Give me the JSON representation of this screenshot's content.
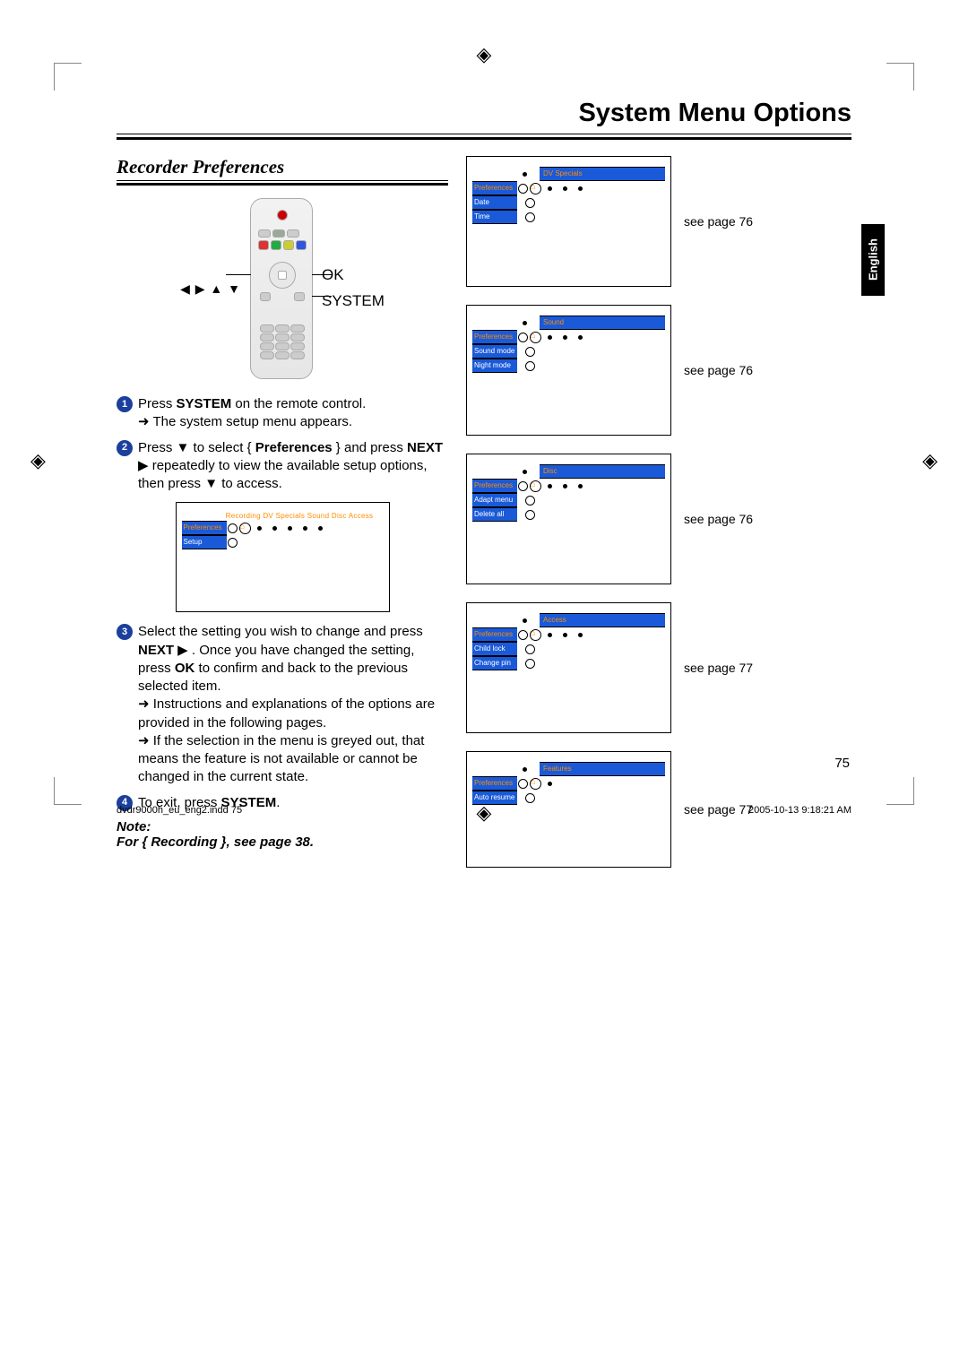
{
  "title": "System Menu Options",
  "section_heading": "Recorder Preferences",
  "language_tab": "English",
  "remote_labels": {
    "arrows": "◀ ▶ ▲ ▼",
    "ok": "OK",
    "system": "SYSTEM"
  },
  "steps": {
    "s1": {
      "num": "1",
      "text_a": "Press ",
      "bold_a": "SYSTEM",
      "text_b": " on the remote control.",
      "indent_a": "➜ The system setup menu appears."
    },
    "s2": {
      "num": "2",
      "text_a": "Press ▼ to select { ",
      "bold_a": "Preferences",
      "text_b": " } and press ",
      "bold_b": "NEXT",
      "text_c": " ▶  repeatedly to view the available setup options, then press ▼ to access."
    },
    "s3": {
      "num": "3",
      "text_a": "Select the setting you wish to change and press ",
      "bold_a": "NEXT",
      "text_b": " ▶ . Once you have changed the setting, press ",
      "bold_b": "OK",
      "text_c": " to confirm and back to the previous selected item.",
      "indent_a": "➜ Instructions and explanations of the options are provided in the following pages.",
      "indent_b": "➜ If the selection in the menu is greyed out, that means the feature is not available or cannot be changed in the current state."
    },
    "s4": {
      "num": "4",
      "text_a": "To exit, press ",
      "bold_a": "SYSTEM",
      "text_b": "."
    }
  },
  "left_menu": {
    "tabs": "Recording   DV Specials   Sound   Disc   Access",
    "row1": "Preferences",
    "row2": "Setup"
  },
  "right_menus": [
    {
      "header": "DV Specials",
      "left": "Preferences",
      "items": [
        "Date",
        "Time"
      ],
      "see": "see page 76"
    },
    {
      "header": "Sound",
      "left": "Preferences",
      "items": [
        "Sound mode",
        "Night mode"
      ],
      "see": "see page 76"
    },
    {
      "header": "Disc",
      "left": "Preferences",
      "items": [
        "Adapt menu",
        "Delete all"
      ],
      "see": "see page 76"
    },
    {
      "header": "Access",
      "left": "Preferences",
      "items": [
        "Child lock",
        "Change pin"
      ],
      "see": "see page 77"
    },
    {
      "header": "Features",
      "left": "Preferences",
      "items": [
        "Auto resume"
      ],
      "see": "see page 77"
    }
  ],
  "note": {
    "label": "Note:",
    "text": "For { Recording }, see page 38."
  },
  "page_number": "75",
  "footer": {
    "left": "dvdr9000h_eu_eng2.indd   75",
    "right": "2005-10-13   9:18:21 AM"
  }
}
